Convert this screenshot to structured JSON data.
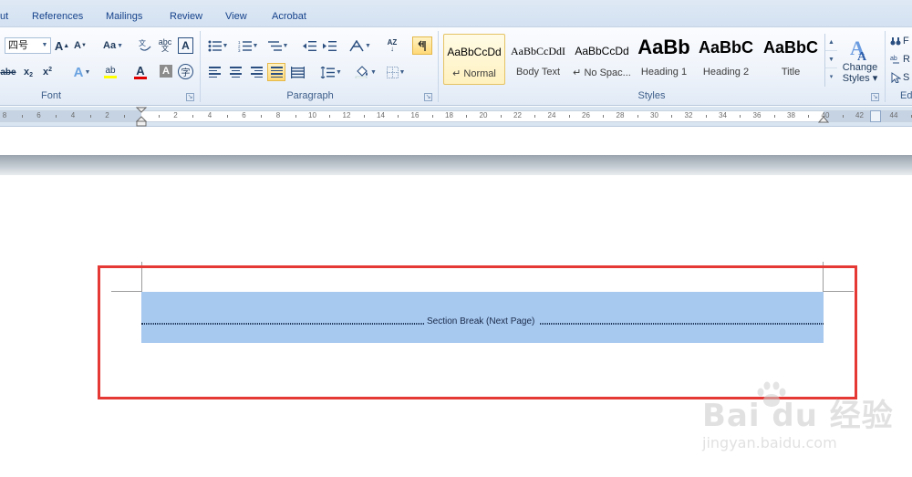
{
  "tabs": [
    "ut",
    "References",
    "Mailings",
    "Review",
    "View",
    "Acrobat"
  ],
  "font_group": {
    "label": "Font",
    "size_value": "四号",
    "grow_font": "A",
    "shrink_font": "A",
    "change_case": "Aa",
    "pinyin": "abc",
    "clear_format": "A",
    "strike": "abe",
    "subscript": "x",
    "superscript": "x",
    "text_effect": "A",
    "highlight": "ab",
    "font_color": "A",
    "char_shading": "A",
    "enclose_char": "字"
  },
  "paragraph_group": {
    "label": "Paragraph",
    "sort": "AZ"
  },
  "styles_group": {
    "label": "Styles",
    "tiles": [
      {
        "sample": "AaBbCcDd",
        "name": "↵ Normal"
      },
      {
        "sample": "AaBbCcDdI",
        "name": "Body Text"
      },
      {
        "sample": "AaBbCcDd",
        "name": "↵ No Spac..."
      },
      {
        "sample": "AaBb",
        "name": "Heading 1"
      },
      {
        "sample": "AaBbC",
        "name": "Heading 2"
      },
      {
        "sample": "AaBbC",
        "name": "Title"
      }
    ],
    "change_styles_line1": "Change",
    "change_styles_line2": "Styles",
    "change_styles_arrow": "▾"
  },
  "editing_group": {
    "label": "Ed",
    "find": "F",
    "replace": "R",
    "select": "S"
  },
  "ruler": {
    "labels": [
      "8",
      "6",
      "4",
      "2",
      "2",
      "4",
      "6",
      "8",
      "10",
      "12",
      "14",
      "16",
      "18",
      "20",
      "22",
      "24",
      "26",
      "28",
      "30",
      "32",
      "34",
      "36",
      "38",
      "40",
      "42",
      "44"
    ]
  },
  "document": {
    "section_break_text": "Section Break (Next Page)"
  },
  "watermark": {
    "main": "Bai du 经验",
    "sub": "jingyan.baidu.com"
  }
}
